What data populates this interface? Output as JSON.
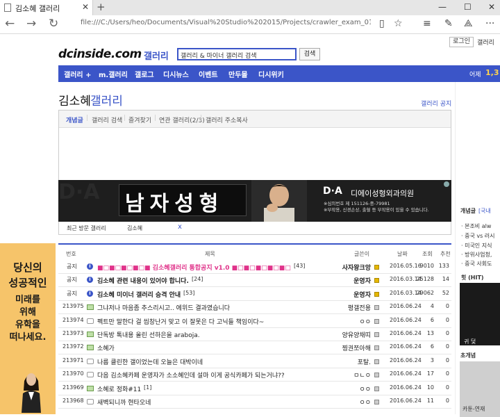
{
  "browser": {
    "tab_title": "김소혜 갤러리",
    "url": "file:///C:/Users/heo/Documents/Visual%20Studio%202015/Projects/crawler_exam_01/crawler_exam_01/respons"
  },
  "header": {
    "login": "로그인",
    "gallery": "갤러리",
    "logo": "dcinside.com",
    "logo_gallery": "갤러리",
    "search_value": "갤러리 & 마이너 갤러리 검색",
    "search_button": "검색"
  },
  "gnb": {
    "items": [
      "갤러리 +",
      "m.갤러리",
      "갤로그",
      "디시뉴스",
      "이벤트",
      "만두몰",
      "디시위키"
    ],
    "visitor_label": "어제",
    "visitor_count": "1,3"
  },
  "gallery": {
    "title_name": "김소혜",
    "title_suffix": "갤러리",
    "notice_link": "갤러리 공지",
    "tabs": [
      "개념글",
      "갤러리 검색",
      "즐겨찾기",
      "연관 갤러리(2/3)",
      "갤러리 주소복사"
    ],
    "recent_label": "최근 방문 갤러리",
    "recent_item": "김소혜",
    "recent_close": "x"
  },
  "banner": {
    "bg_text": "D·A",
    "main_text": "남자성형",
    "logo": "D·A",
    "hospital": "디에이성형외과의원",
    "info1": "※심의번호 제 151126-중-79981",
    "info2": "※부작용, 신경손상, 출혈 등 부작용이 있을 수 있습니다."
  },
  "table": {
    "headers": [
      "번호",
      "제목",
      "글쓴이",
      "날짜",
      "조회",
      "추천"
    ],
    "rows": [
      {
        "no": "공지",
        "icon": "info",
        "title": "■□■□■□■□■ 김소혜갤러리 통합공지 v1.0 ■□■□■□■□■□",
        "count": "[43]",
        "writer": "사자왕크앙",
        "date": "2016.05.16",
        "views": "9010",
        "recommend": "133",
        "hot": true
      },
      {
        "no": "공지",
        "icon": "info",
        "title": "김소혜 관련 내용이 있어야 합니다.",
        "count": "[24]",
        "writer": "운영자",
        "date": "2016.03.14",
        "views": "25128",
        "recommend": "14",
        "bold": true
      },
      {
        "no": "공지",
        "icon": "info",
        "title": "김소혜 미이너 갤러리 승격 안내",
        "count": "[53]",
        "writer": "운영자",
        "date": "2016.03.14",
        "views": "29062",
        "recommend": "52",
        "bold": true
      },
      {
        "no": "213975",
        "icon": "pic",
        "title": "그냐저나 마음좀 추스리시고.. 에위드 결과였습니다",
        "count": "",
        "writer": "평갤전용",
        "date": "2016.06.24",
        "views": "4",
        "recommend": "0"
      },
      {
        "no": "213974",
        "icon": "txt",
        "title": "펙트만 말한다 걸 씹창난거 맞고 이 잘못은 다 고닉들 책임이다~",
        "count": "",
        "writer": "ㅇㅇ",
        "date": "2016.06.24",
        "views": "6",
        "recommend": "0"
      },
      {
        "no": "213973",
        "icon": "pic",
        "title": "단독방 톡내용 올린 선하은을 araboja.",
        "count": "",
        "writer": "양유양채띠",
        "date": "2016.06.24",
        "views": "13",
        "recommend": "0"
      },
      {
        "no": "213972",
        "icon": "pic",
        "title": "소혜가",
        "count": "",
        "writer": "찡권쪼아해",
        "date": "2016.06.24",
        "views": "6",
        "recommend": "0"
      },
      {
        "no": "213971",
        "icon": "txt",
        "title": "나름 클린한 갤이었는데 오늘은 대박이네",
        "count": "",
        "writer": "포탈.",
        "date": "2016.06.24",
        "views": "3",
        "recommend": "0"
      },
      {
        "no": "213970",
        "icon": "txt",
        "title": "다음 김소혜카페 운영자가 소소혜인데 설마 이게 공식카페가 되는거냐??",
        "count": "",
        "writer": "ㅁㄴㅇ",
        "date": "2016.06.24",
        "views": "17",
        "recommend": "0"
      },
      {
        "no": "213969",
        "icon": "pic",
        "title": "소혜로 정화#11",
        "count": "[1]",
        "writer": "ㅇㅇ",
        "date": "2016.06.24",
        "views": "10",
        "recommend": "0"
      },
      {
        "no": "213968",
        "icon": "txt",
        "title": "새벽되니까 현타오네",
        "count": "",
        "writer": "ㅇㅇ",
        "date": "2016.06.24",
        "views": "11",
        "recommend": "0"
      }
    ]
  },
  "left_ad": {
    "line1": "당신의",
    "line2": "성공적인",
    "line3": "미래를",
    "line4": "위해",
    "line5": "유학을",
    "line6": "떠나세요."
  },
  "right_col": {
    "header": "개념글",
    "header_link": "[국내",
    "items": [
      "· 본조비 alw",
      "· 중국 vs 러시",
      "· 미국인 지식",
      "· 방위사업청,",
      "· 중국 사회도"
    ],
    "hit_label": "힛 (HIT)",
    "thumb_caption": "귀 덫",
    "gallery_label": "초개념",
    "bottom_caption": "카툰-연재"
  },
  "colors": {
    "accent": "#3b55c8",
    "hot": "#e0338a",
    "ad_bg": "#f6c46a"
  }
}
